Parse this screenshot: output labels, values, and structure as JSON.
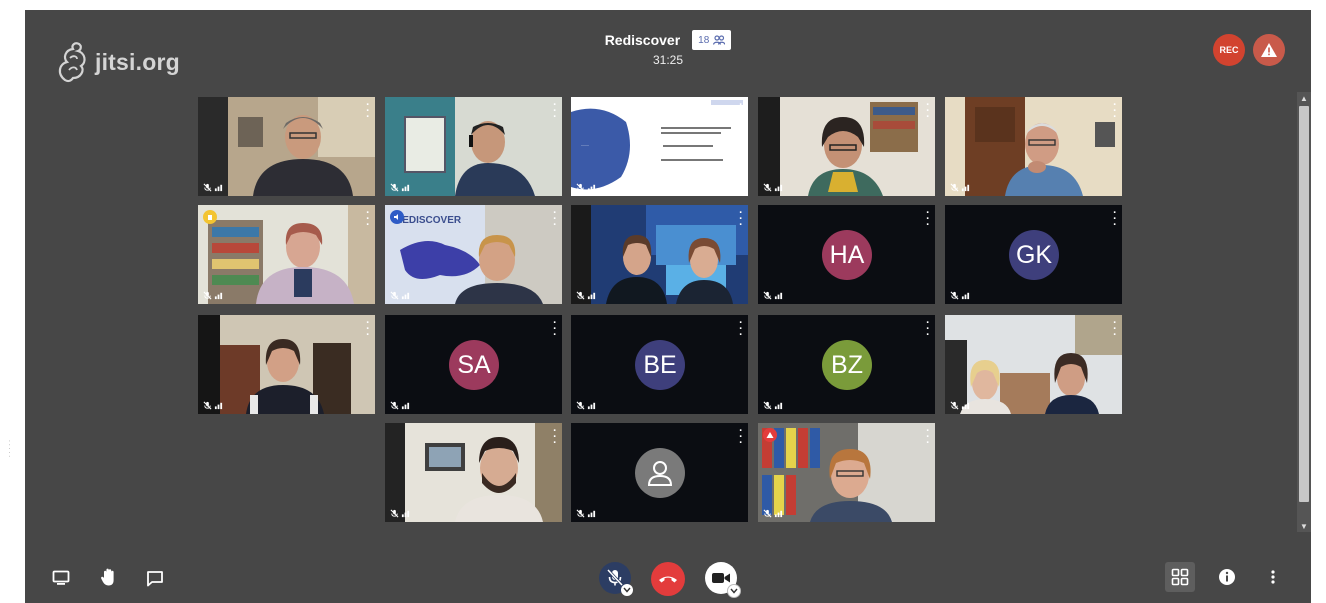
{
  "app": {
    "logo_text": "jitsi.org"
  },
  "margin_text": "· · · · ·",
  "header": {
    "title": "Rediscover",
    "participant_count": "18",
    "timer": "31:25"
  },
  "recording": {
    "label": "REC"
  },
  "tiles": [
    {
      "type": "video",
      "scene": "woman-glasses-room"
    },
    {
      "type": "video",
      "scene": "man-headset-window"
    },
    {
      "type": "screen",
      "scene": "presentation-slide"
    },
    {
      "type": "video",
      "scene": "woman-headset-office"
    },
    {
      "type": "video",
      "scene": "man-glasses-door"
    },
    {
      "type": "video",
      "scene": "woman-bookshelf",
      "badge": "yellow"
    },
    {
      "type": "video",
      "scene": "man-rediscover-map",
      "badge": "blue-speaker",
      "active": true
    },
    {
      "type": "video",
      "scene": "two-women-poster"
    },
    {
      "type": "avatar",
      "initials": "HA",
      "color": "#9c3a5d"
    },
    {
      "type": "avatar",
      "initials": "GK",
      "color": "#3e3f7c"
    },
    {
      "type": "video",
      "scene": "woman-striped"
    },
    {
      "type": "avatar",
      "initials": "SA",
      "color": "#9c3a5d"
    },
    {
      "type": "avatar",
      "initials": "BE",
      "color": "#3e3f7c"
    },
    {
      "type": "avatar",
      "initials": "BZ",
      "color": "#7a9b3a"
    },
    {
      "type": "video",
      "scene": "two-women-blonde"
    },
    {
      "type": "video",
      "scene": "man-beard-lamp"
    },
    {
      "type": "avatar",
      "initials": "",
      "color": "#7a7a7a",
      "placeholder": true
    },
    {
      "type": "video",
      "scene": "woman-binders",
      "badge": "red"
    }
  ],
  "toolbar": {
    "left": [
      "screen-share-icon",
      "raise-hand-icon",
      "chat-icon"
    ],
    "center": [
      "mic-muted-icon",
      "hangup-icon",
      "camera-icon"
    ],
    "right": [
      "tile-view-icon",
      "info-icon",
      "more-options-icon"
    ]
  },
  "colors": {
    "background": "#474747",
    "tile": "#0b0d12",
    "hangup": "#e33c3c",
    "rec": "#d2432f",
    "active_border": "#3c6bc6"
  }
}
